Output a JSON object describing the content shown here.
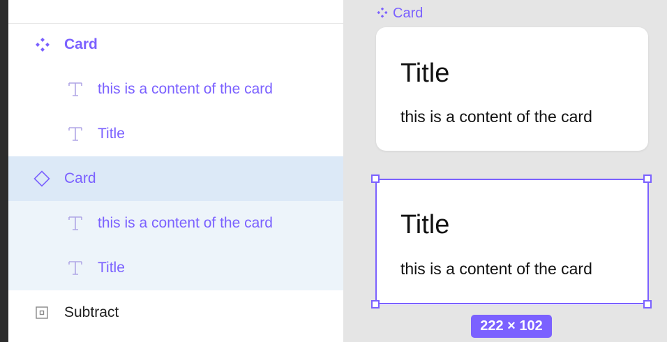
{
  "layers_panel": {
    "tabs": [],
    "layers": [
      {
        "name": "Card",
        "type": "component-set",
        "level": 0,
        "selected": false
      },
      {
        "name": "this is a content of the card",
        "type": "text",
        "level": 1,
        "selected": false
      },
      {
        "name": "Title",
        "type": "text",
        "level": 1,
        "selected": false
      },
      {
        "name": "Card",
        "type": "component-instance",
        "level": 0,
        "selected": true
      },
      {
        "name": "this is a content of the card",
        "type": "text",
        "level": 1,
        "selected": false
      },
      {
        "name": "Title",
        "type": "text",
        "level": 1,
        "selected": false
      },
      {
        "name": "Subtract",
        "type": "boolean-subtract",
        "level": 0,
        "selected": false
      }
    ]
  },
  "canvas": {
    "component_label": "Card",
    "main_card": {
      "title": "Title",
      "content": "this is a content of the card"
    },
    "instance_card": {
      "title": "Title",
      "content": "this is a content of the card"
    },
    "selection_size": "222 × 102"
  },
  "colors": {
    "accent": "#7b61ff",
    "selected_row": "#dce9f7",
    "selected_child_row": "#edf4fa",
    "canvas_bg": "#e5e5e5"
  }
}
